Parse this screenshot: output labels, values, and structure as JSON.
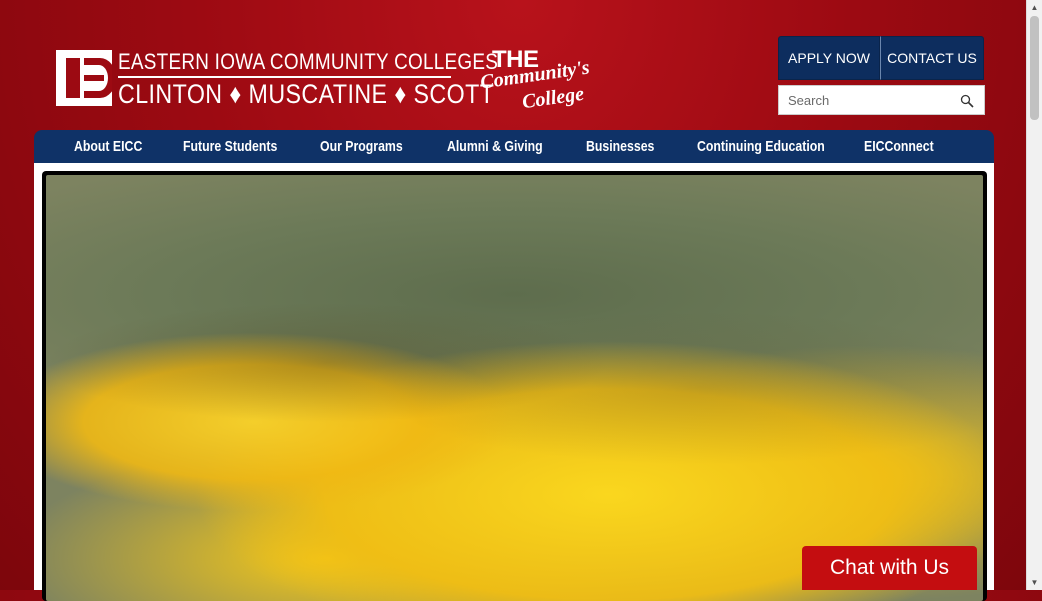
{
  "header": {
    "logo_line1": "EASTERN IOWA COMMUNITY COLLEGES",
    "logo_line2": "CLINTON ♦ MUSCATINE ♦ SCOTT",
    "tagline": {
      "line1": "THE",
      "line2": "Community's",
      "line3": "College"
    },
    "apply_label": "APPLY NOW",
    "contact_label": "CONTACT US",
    "search_placeholder": "Search"
  },
  "nav": {
    "items": [
      {
        "label": "About EICC"
      },
      {
        "label": "Future Students"
      },
      {
        "label": "Our Programs"
      },
      {
        "label": "Alumni & Giving"
      },
      {
        "label": "Businesses"
      },
      {
        "label": "Continuing Education"
      },
      {
        "label": "EICConnect"
      }
    ]
  },
  "chat": {
    "label": "Chat with Us"
  },
  "colors": {
    "background_red": "#9c0a12",
    "nav_blue": "#0f3267",
    "button_blue": "#0d2d5e",
    "chat_red": "#c40d10"
  }
}
